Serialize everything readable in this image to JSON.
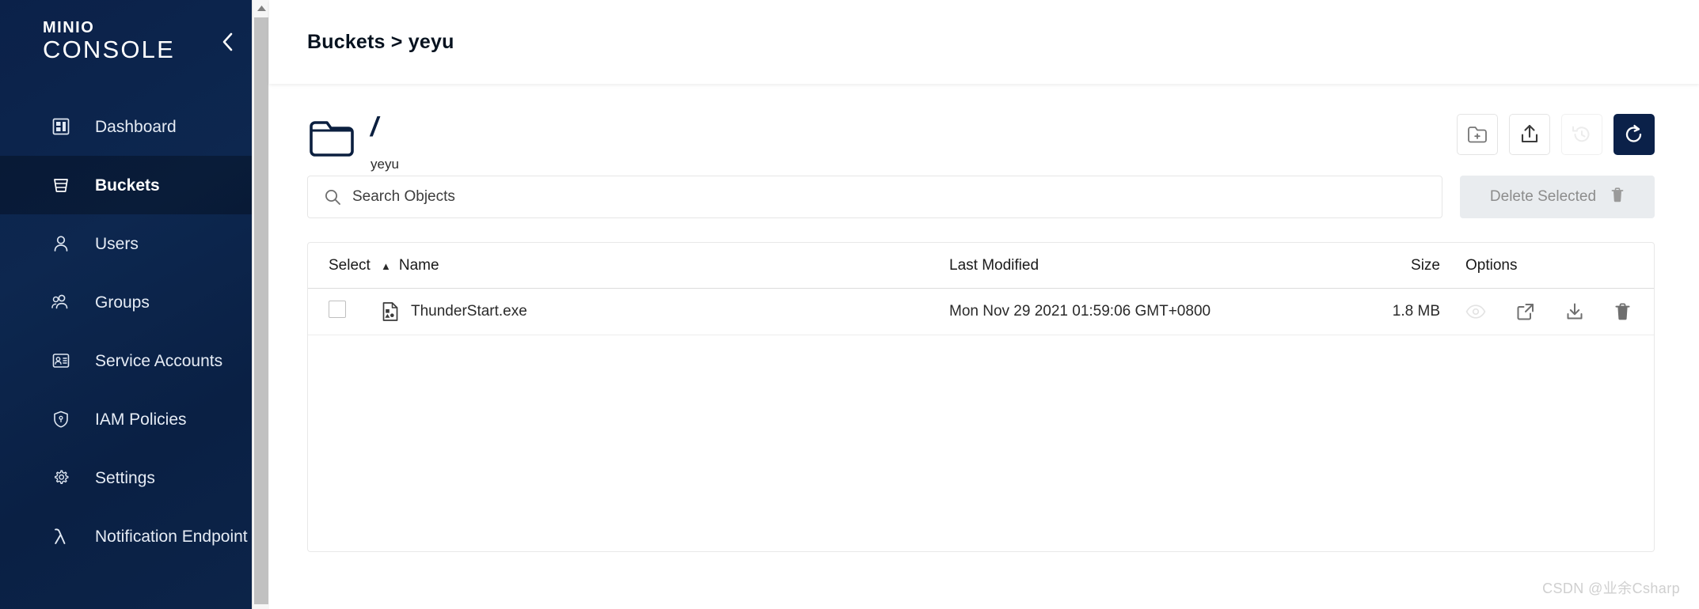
{
  "sidebar": {
    "logo": {
      "brand": "MINIO",
      "product": "CONSOLE"
    },
    "collapse_icon": "chevron-left-icon",
    "items": [
      {
        "label": "Dashboard",
        "icon": "dashboard-icon",
        "active": false
      },
      {
        "label": "Buckets",
        "icon": "bucket-icon",
        "active": true
      },
      {
        "label": "Users",
        "icon": "user-icon",
        "active": false
      },
      {
        "label": "Groups",
        "icon": "groups-icon",
        "active": false
      },
      {
        "label": "Service Accounts",
        "icon": "id-card-icon",
        "active": false
      },
      {
        "label": "IAM Policies",
        "icon": "shield-icon",
        "active": false
      },
      {
        "label": "Settings",
        "icon": "gear-icon",
        "active": false
      },
      {
        "label": "Notification Endpoint",
        "icon": "lambda-icon",
        "active": false
      }
    ]
  },
  "header": {
    "breadcrumb": "Buckets > yeyu"
  },
  "path": {
    "folder_icon": "folder-icon",
    "separator": "/",
    "bucket_name": "yeyu"
  },
  "actions": [
    {
      "name": "create-new-path-button",
      "icon": "folder-plus-icon",
      "state": "enabled"
    },
    {
      "name": "upload-button",
      "icon": "upload-icon",
      "state": "enabled"
    },
    {
      "name": "history-button",
      "icon": "history-icon",
      "state": "disabled"
    },
    {
      "name": "refresh-button",
      "icon": "refresh-icon",
      "state": "primary"
    }
  ],
  "search": {
    "placeholder": "Search Objects",
    "value": "",
    "icon": "search-icon"
  },
  "delete_selected": {
    "label": "Delete Selected",
    "icon": "trash-icon",
    "state": "disabled"
  },
  "table": {
    "columns": {
      "select": "Select",
      "name": "Name",
      "last_modified": "Last Modified",
      "size": "Size",
      "options": "Options"
    },
    "sort": {
      "column": "Name",
      "direction": "asc",
      "caret": "▲"
    },
    "rows": [
      {
        "selected": false,
        "icon": "file-binary-icon",
        "name": "ThunderStart.exe",
        "last_modified": "Mon Nov 29 2021 01:59:06 GMT+0800",
        "size": "1.8 MB",
        "options": [
          {
            "name": "preview-icon",
            "state": "disabled"
          },
          {
            "name": "share-icon",
            "state": "enabled"
          },
          {
            "name": "download-icon",
            "state": "enabled"
          },
          {
            "name": "delete-icon",
            "state": "enabled"
          }
        ]
      }
    ]
  },
  "watermark": "CSDN @业余Csharp",
  "colors": {
    "sidebar_bg": "#0b2149",
    "primary": "#0b2149",
    "accent_text": "#ffffff",
    "disabled_bg": "#e9ecef"
  }
}
